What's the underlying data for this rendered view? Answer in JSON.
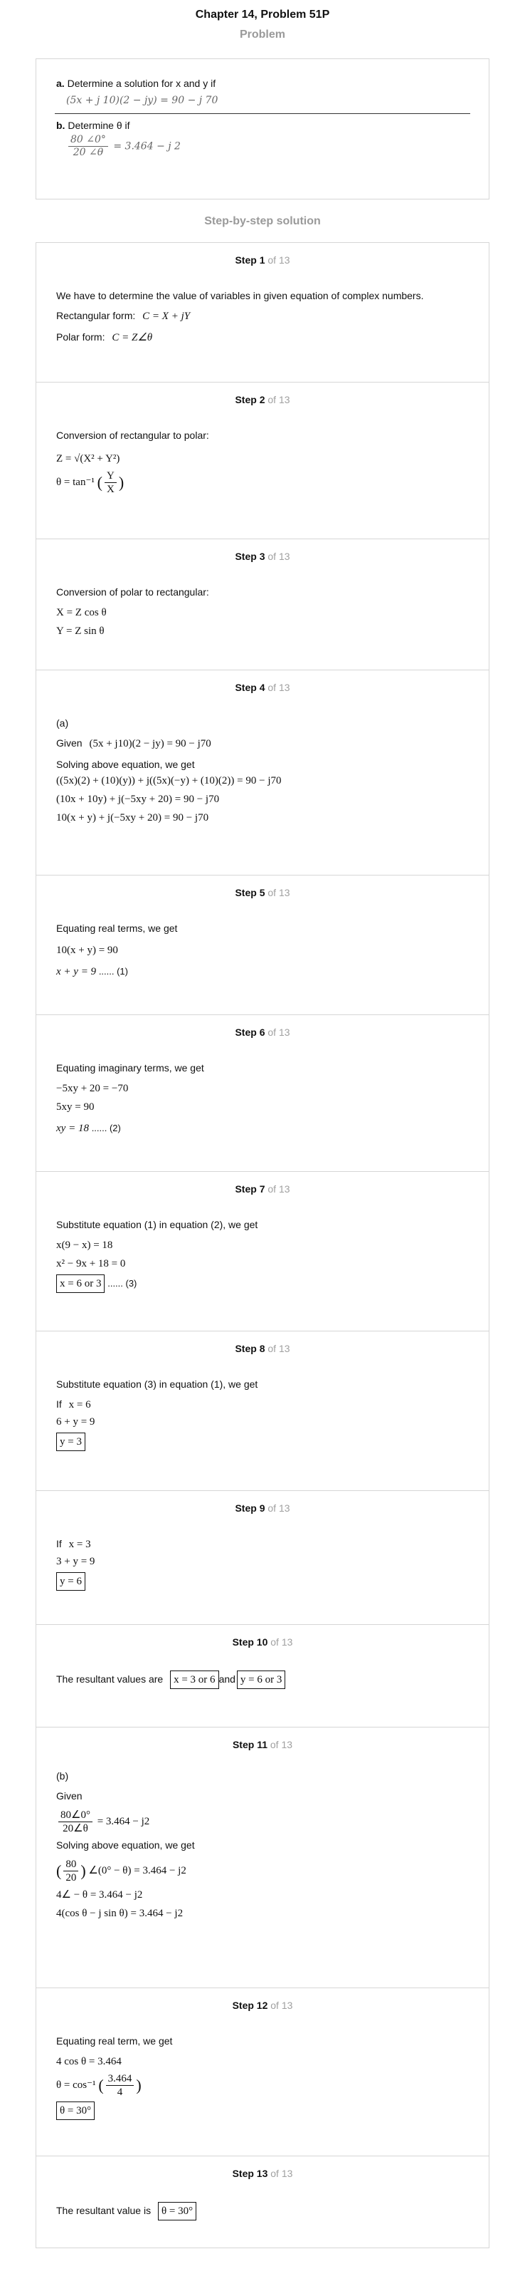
{
  "title": "Chapter 14, Problem 51P",
  "problem_heading": "Problem",
  "problem": {
    "a_label": "a.",
    "a_text": "Determine a solution for x and y if",
    "a_eq": "(5x + j 10)(2 − jy) = 90 − j 70",
    "b_label": "b.",
    "b_text": "Determine θ if",
    "b_num": "80 ∠0°",
    "b_den": "20 ∠θ",
    "b_rhs": "= 3.464 − j 2"
  },
  "solution_heading": "Step-by-step solution",
  "step_word": "Step",
  "of_word": "of",
  "total_steps": "13",
  "steps": [
    {
      "n": "1",
      "t1": "We have to determine the value of variables in given equation of complex numbers.",
      "t2": "Rectangular form:",
      "e2": "C = X + jY",
      "t3": "Polar form:",
      "e3": "C = Z∠θ"
    },
    {
      "n": "2",
      "t1": "Conversion of rectangular to polar:",
      "e1": "Z = √(X² + Y²)",
      "e2a": "θ = tan⁻¹",
      "e2n": "Y",
      "e2d": "X"
    },
    {
      "n": "3",
      "t1": "Conversion of polar to rectangular:",
      "e1": "X = Z cos θ",
      "e2": "Y = Z sin θ"
    },
    {
      "n": "4",
      "t0": "(a)",
      "t1": "Given",
      "e1": "(5x + j10)(2 − jy) = 90 − j70",
      "t2": "Solving above equation, we get",
      "e2": "((5x)(2) + (10)(y)) + j((5x)(−y) + (10)(2)) = 90 − j70",
      "e3": "(10x + 10y) + j(−5xy + 20) = 90 − j70",
      "e4": "10(x + y) + j(−5xy + 20) = 90 − j70"
    },
    {
      "n": "5",
      "t1": "Equating real terms, we get",
      "e1": "10(x + y) = 90",
      "e2": "x + y = 9",
      "e2s": "...... (1)"
    },
    {
      "n": "6",
      "t1": "Equating imaginary terms, we get",
      "e1": "−5xy + 20 = −70",
      "e2": "5xy = 90",
      "e3": "xy = 18",
      "e3s": "...... (2)"
    },
    {
      "n": "7",
      "t1": "Substitute equation (1) in equation (2), we get",
      "e1": "x(9 − x) = 18",
      "e2": "x² − 9x + 18 = 0",
      "e3": "x = 6 or 3",
      "e3s": "...... (3)"
    },
    {
      "n": "8",
      "t1": "Substitute equation (3) in equation (1), we get",
      "t2": "If",
      "e2": "x = 6",
      "e3": "6 + y = 9",
      "e4": "y = 3"
    },
    {
      "n": "9",
      "t2": "If",
      "e2": "x = 3",
      "e3": "3 + y = 9",
      "e4": "y = 6"
    },
    {
      "n": "10",
      "t1": "The resultant values are",
      "e1": "x = 3 or 6",
      "and": "and",
      "e2": "y = 6 or 3"
    },
    {
      "n": "11",
      "t0": "(b)",
      "t1": "Given",
      "e1n": "80∠0°",
      "e1d": "20∠θ",
      "e1r": "= 3.464 − j2",
      "t2": "Solving above equation, we get",
      "e2n": "80",
      "e2d": "20",
      "e2r": "∠(0° − θ) = 3.464 − j2",
      "e3": "4∠ − θ = 3.464 − j2",
      "e4": "4(cos θ − j sin θ) = 3.464 − j2"
    },
    {
      "n": "12",
      "t1": "Equating real term, we get",
      "e1": "4 cos θ = 3.464",
      "e2a": "θ = cos⁻¹",
      "e2n": "3.464",
      "e2d": "4",
      "e3": "θ = 30°"
    },
    {
      "n": "13",
      "t1": "The resultant value is",
      "e1": "θ = 30°"
    }
  ]
}
